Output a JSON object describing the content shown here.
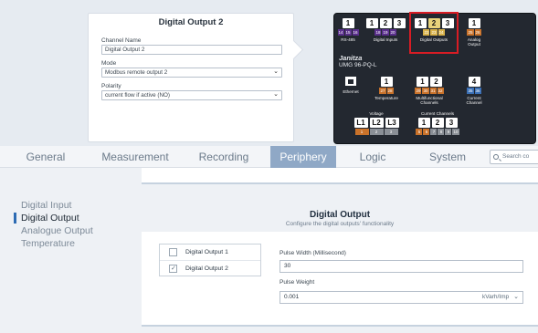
{
  "popup": {
    "title": "Digital Output 2",
    "channel_name_label": "Channel Name",
    "channel_name_value": "Digital Output 2",
    "mode_label": "Mode",
    "mode_value": "Modbus remote output 2",
    "polarity_label": "Polarity",
    "polarity_value": "current flow if active (NO)"
  },
  "device": {
    "brand": "Janitza",
    "model": "UMG 96-PQ-L",
    "groups": {
      "rs485": {
        "nums": [
          "1"
        ],
        "pins": [
          "14",
          "15",
          "16"
        ],
        "caption": "RS-485"
      },
      "digital_inputs": {
        "nums": [
          "1",
          "2",
          "3"
        ],
        "pins": [
          "18",
          "19",
          "20"
        ],
        "caption": "Digital Inputs"
      },
      "digital_outputs": {
        "nums": [
          "1",
          "2",
          "3"
        ],
        "pins": [
          "22",
          "23",
          "24"
        ],
        "caption": "Digital Outputs"
      },
      "analog_output": {
        "nums": [
          "1"
        ],
        "pins": [
          "25",
          "26"
        ],
        "caption": "Analog Output"
      },
      "ethernet": {
        "caption": "Ethernet"
      },
      "temperature": {
        "nums": [
          "1"
        ],
        "pins": [
          "27",
          "28"
        ],
        "caption": "Temperature"
      },
      "multifunctional": {
        "nums": [
          "1",
          "2"
        ],
        "pins": [
          "29",
          "30",
          "31",
          "32"
        ],
        "caption": "Multifunctional Channels"
      },
      "current_channel": {
        "nums": [
          "4"
        ],
        "pins": [
          "35",
          "36"
        ],
        "caption": "Current Channel"
      },
      "voltage": {
        "nums": [
          "L1",
          "L2",
          "L3"
        ],
        "pins": [
          "1",
          "2",
          "3"
        ],
        "caption": "Voltage"
      },
      "current_channels": {
        "nums": [
          "1",
          "2",
          "3"
        ],
        "pins": [
          "5",
          "6",
          "7",
          "8",
          "9",
          "10"
        ],
        "caption": "Current Channels"
      }
    },
    "colors": {
      "highlight": "#d81c24",
      "pin_orange": "#c9722a",
      "pin_purple": "#5a2f8c",
      "pin_gray": "#8a8f96",
      "pin_yellow": "#d8b24a",
      "pin_blue": "#3a6fb5"
    }
  },
  "tabs": [
    {
      "label": "General",
      "active": false
    },
    {
      "label": "Measurement",
      "active": false
    },
    {
      "label": "Recording",
      "active": false
    },
    {
      "label": "Periphery",
      "active": true
    },
    {
      "label": "Logic",
      "active": false
    },
    {
      "label": "System",
      "active": false
    }
  ],
  "search": {
    "placeholder": "Search co"
  },
  "sidebar": {
    "items": [
      {
        "label": "Digital Input",
        "active": false
      },
      {
        "label": "Digital Output",
        "active": true
      },
      {
        "label": "Analogue Output",
        "active": false
      },
      {
        "label": "Temperature",
        "active": false
      }
    ]
  },
  "panel": {
    "title": "Digital Output",
    "subtitle": "Configure the digital outputs' functionality",
    "outputs": [
      {
        "label": "Digital Output 1",
        "checked": false
      },
      {
        "label": "Digital Output 2",
        "checked": true
      }
    ],
    "pulse_width_label": "Pulse Width (Millisecond)",
    "pulse_width_value": "30",
    "pulse_weight_label": "Pulse Weight",
    "pulse_weight_value": "0.001",
    "pulse_weight_unit": "kVarh/Imp"
  },
  "accent": "#8fa8c6"
}
